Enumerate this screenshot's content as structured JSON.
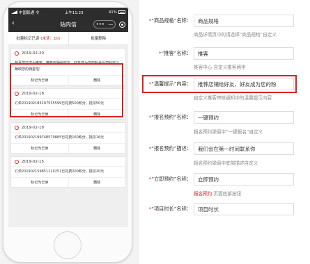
{
  "phone": {
    "status": {
      "carrier": "中国联通",
      "wifi": "令",
      "time": "上午11:23",
      "battery_pct": "41%"
    },
    "nav": {
      "back": "‹",
      "title": "站内信",
      "capsule_more": "•••",
      "capsule_minus": "—"
    },
    "actions": {
      "mark_all": "批量标记已读",
      "unread": "(未读：10)",
      "delete_all": "批量删除"
    },
    "cards": [
      {
        "date": "2019-02-20",
        "body": "恭喜您已成为推客。推荐店铺给好友，好友成为您的粉丝后您就可以赚取您的佣金啦!",
        "mark": "标记为已读",
        "del": "删除"
      },
      {
        "date": "2019-02-18",
        "body": "订单201902185197535599已花费500积分，抵扣50元",
        "mark": "标记为已读",
        "del": "删除"
      },
      {
        "date": "2019-02-18",
        "body": "订单201902189748579885已花费160积分，抵扣16元",
        "mark": "标记为已读",
        "del": "删除"
      },
      {
        "date": "2019-02-15",
        "body": "订单201902159851110251已花费200积分，抵扣20元",
        "mark": "标记为已读",
        "del": "删除"
      }
    ]
  },
  "form": {
    "rows": [
      {
        "star": "*",
        "label": "“商品规格”名称：",
        "value": "商品规格",
        "help": "商品详情页中的请选择“商品规格”自定义"
      },
      {
        "star": "*",
        "label": "“推客”名称：",
        "value": "推客",
        "help": "推客中心 自定义推客两字"
      },
      {
        "star": "*",
        "label": "“温馨提示”内容：",
        "value": "推荐店铺给好友，好友成为您的粉",
        "help": "自定义推客审核通知中的温馨提示内容"
      },
      {
        "star": "*",
        "label": "“报名预约”名称：",
        "value": "一键预约",
        "help": "报名预约弹窗中“一键报名”自定义"
      },
      {
        "star": "*",
        "label": "“报名预约”描述：",
        "value": "我们会在第一时间联系你",
        "help": "报名预约弹窗中底部描述自定义"
      },
      {
        "star": "*",
        "label": "“立即预约”名称：",
        "value": "立即预约",
        "help_red": "报名预约",
        "help": " 页面底部按钮"
      },
      {
        "star": "*",
        "label": "“项目时长”名称：",
        "value": "项目时长",
        "help": ""
      }
    ]
  }
}
